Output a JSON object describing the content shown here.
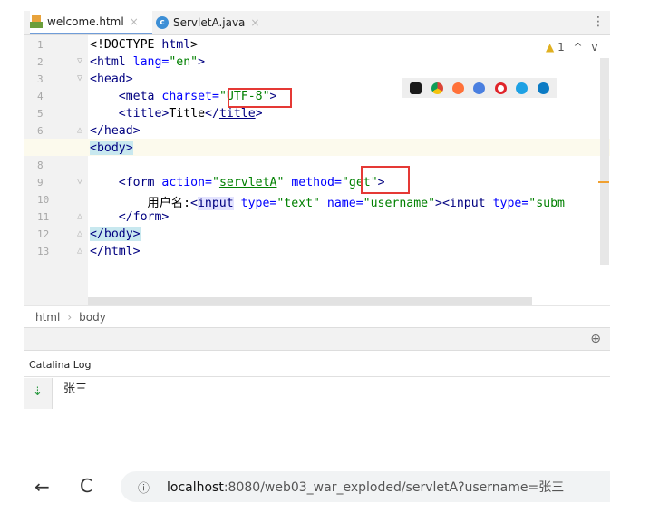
{
  "tabs": [
    {
      "label": "welcome.html",
      "close": "×",
      "icon": "html-file-icon"
    },
    {
      "label": "ServletA.java",
      "close": "×",
      "icon": "java-class-icon"
    }
  ],
  "editor": {
    "line_numbers": [
      "1",
      "2",
      "3",
      "4",
      "5",
      "6",
      "7",
      "8",
      "9",
      "10",
      "11",
      "12",
      "13"
    ],
    "inspection": {
      "symbol": "▲",
      "count": "1",
      "up": "^",
      "down": "v"
    },
    "colors": {
      "tag": "#000080",
      "attr": "#0000ff",
      "value": "#008000",
      "highlight": "#e53935"
    }
  },
  "breadcrumb": {
    "items": [
      "html",
      "body"
    ],
    "separator": "›"
  },
  "log": {
    "title": "Catalina Log",
    "output": "张三"
  },
  "browser": {
    "back": "←",
    "reload": "C",
    "info": "ⓘ",
    "host": "localhost",
    "url_rest": ":8080/web03_war_exploded/servletA?username=张三"
  }
}
